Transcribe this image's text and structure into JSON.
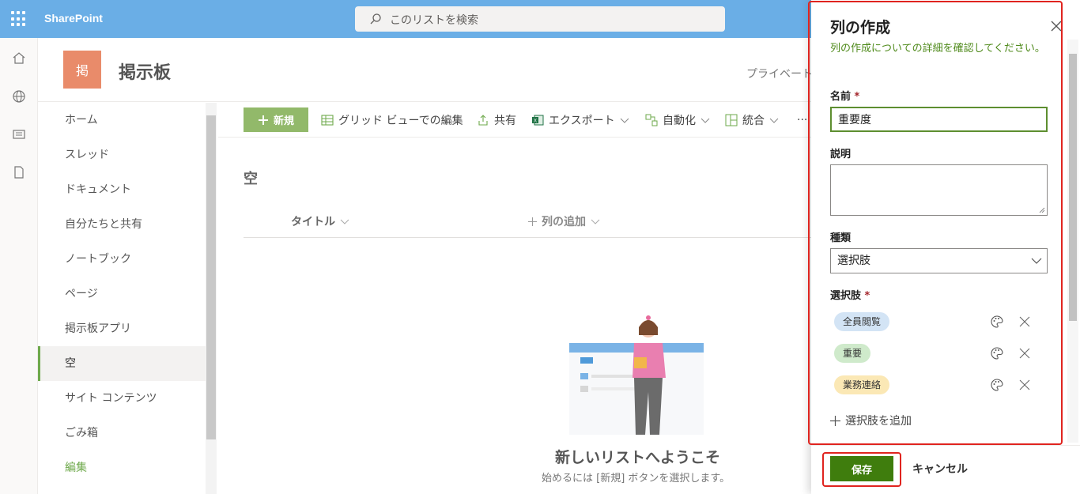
{
  "topbar": {
    "app_name": "SharePoint",
    "search_placeholder": "このリストを検索",
    "color": "#6aaee6"
  },
  "rail": {
    "icons": [
      "home-icon",
      "globe-icon",
      "news-icon",
      "document-icon"
    ]
  },
  "site": {
    "logo_text": "掲",
    "logo_color": "#e98b6a",
    "title": "掲示板",
    "privacy": "プライベート"
  },
  "nav": {
    "items": [
      {
        "label": "ホーム"
      },
      {
        "label": "スレッド"
      },
      {
        "label": "ドキュメント"
      },
      {
        "label": "自分たちと共有"
      },
      {
        "label": "ノートブック"
      },
      {
        "label": "ページ"
      },
      {
        "label": "掲示板アプリ"
      },
      {
        "label": "空",
        "selected": true
      },
      {
        "label": "サイト コンテンツ"
      },
      {
        "label": "ごみ箱"
      },
      {
        "label": "編集",
        "edit": true
      }
    ]
  },
  "commandbar": {
    "new": "新規",
    "grid_edit": "グリッド ビューでの編集",
    "share": "共有",
    "export": "エクスポート",
    "automate": "自動化",
    "integrate": "統合",
    "more": "···"
  },
  "list": {
    "view_name": "空",
    "columns": {
      "title": "タイトル",
      "add_column": "列の追加"
    },
    "empty_title": "新しいリストへようこそ",
    "empty_subtitle": "始めるには [新規] ボタンを選択します。"
  },
  "panel": {
    "title": "列の作成",
    "description": "列の作成についての詳細を確認してください。",
    "name_label": "名前",
    "name_value": "重要度",
    "desc_label": "説明",
    "desc_value": "",
    "type_label": "種類",
    "type_value": "選択肢",
    "choices_label": "選択肢",
    "required_mark": "*",
    "choices": [
      {
        "label": "全員閲覧",
        "color": "#d3e4f5"
      },
      {
        "label": "重要",
        "color": "#cfeacb"
      },
      {
        "label": "業務連絡",
        "color": "#fbe8b5"
      }
    ],
    "add_choice": "選択肢を追加",
    "save": "保存",
    "cancel": "キャンセル",
    "accent": "#3f7d0d",
    "highlight": "#e0241f"
  }
}
